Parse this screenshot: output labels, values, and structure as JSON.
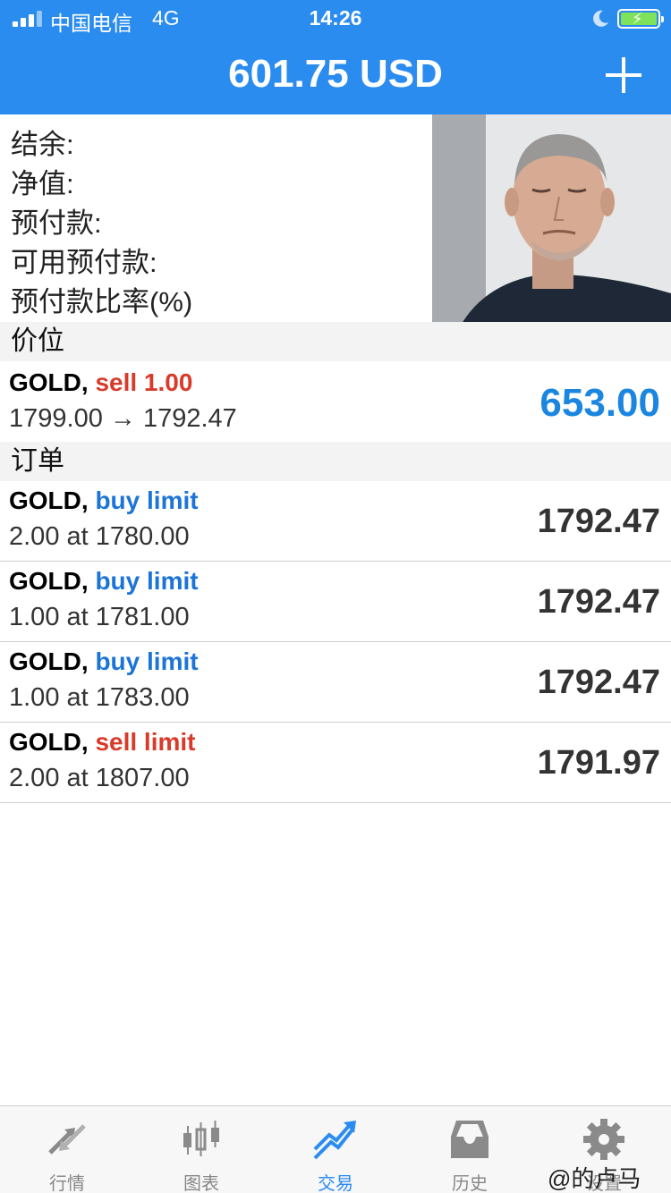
{
  "status_bar": {
    "carrier": "中国电信",
    "network": "4G",
    "time": "14:26"
  },
  "header": {
    "title": "601.75 USD",
    "add_icon": "plus-icon"
  },
  "summary": {
    "labels": [
      "结余:",
      "净值:",
      "预付款:",
      "可用预付款:",
      "预付款比率(%)"
    ]
  },
  "positions": {
    "header": "价位",
    "items": [
      {
        "symbol": "GOLD,",
        "action": "sell 1.00",
        "action_type": "sell",
        "detail": "1799.00 → 1792.47",
        "value": "653.00"
      }
    ]
  },
  "orders": {
    "header": "订单",
    "items": [
      {
        "symbol": "GOLD,",
        "action": "buy limit",
        "action_type": "buy",
        "detail": "2.00 at 1780.00",
        "value": "1792.47"
      },
      {
        "symbol": "GOLD,",
        "action": "buy limit",
        "action_type": "buy",
        "detail": "1.00 at 1781.00",
        "value": "1792.47"
      },
      {
        "symbol": "GOLD,",
        "action": "buy limit",
        "action_type": "buy",
        "detail": "1.00 at 1783.00",
        "value": "1792.47"
      },
      {
        "symbol": "GOLD,",
        "action": "sell limit",
        "action_type": "sell",
        "detail": "2.00 at 1807.00",
        "value": "1791.97"
      }
    ]
  },
  "tabbar": {
    "tabs": [
      {
        "label": "行情",
        "icon": "quotes-arrows-icon"
      },
      {
        "label": "图表",
        "icon": "candlestick-chart-icon"
      },
      {
        "label": "交易",
        "icon": "trade-trend-icon",
        "active": true
      },
      {
        "label": "历史",
        "icon": "history-inbox-icon"
      },
      {
        "label": "设置",
        "icon": "settings-gear-icon"
      }
    ]
  },
  "watermark": "@的卢马",
  "colors": {
    "accent": "#2b8cf0",
    "sell": "#d93a2a",
    "buy": "#1b74d6",
    "profit": "#1b86e0"
  }
}
